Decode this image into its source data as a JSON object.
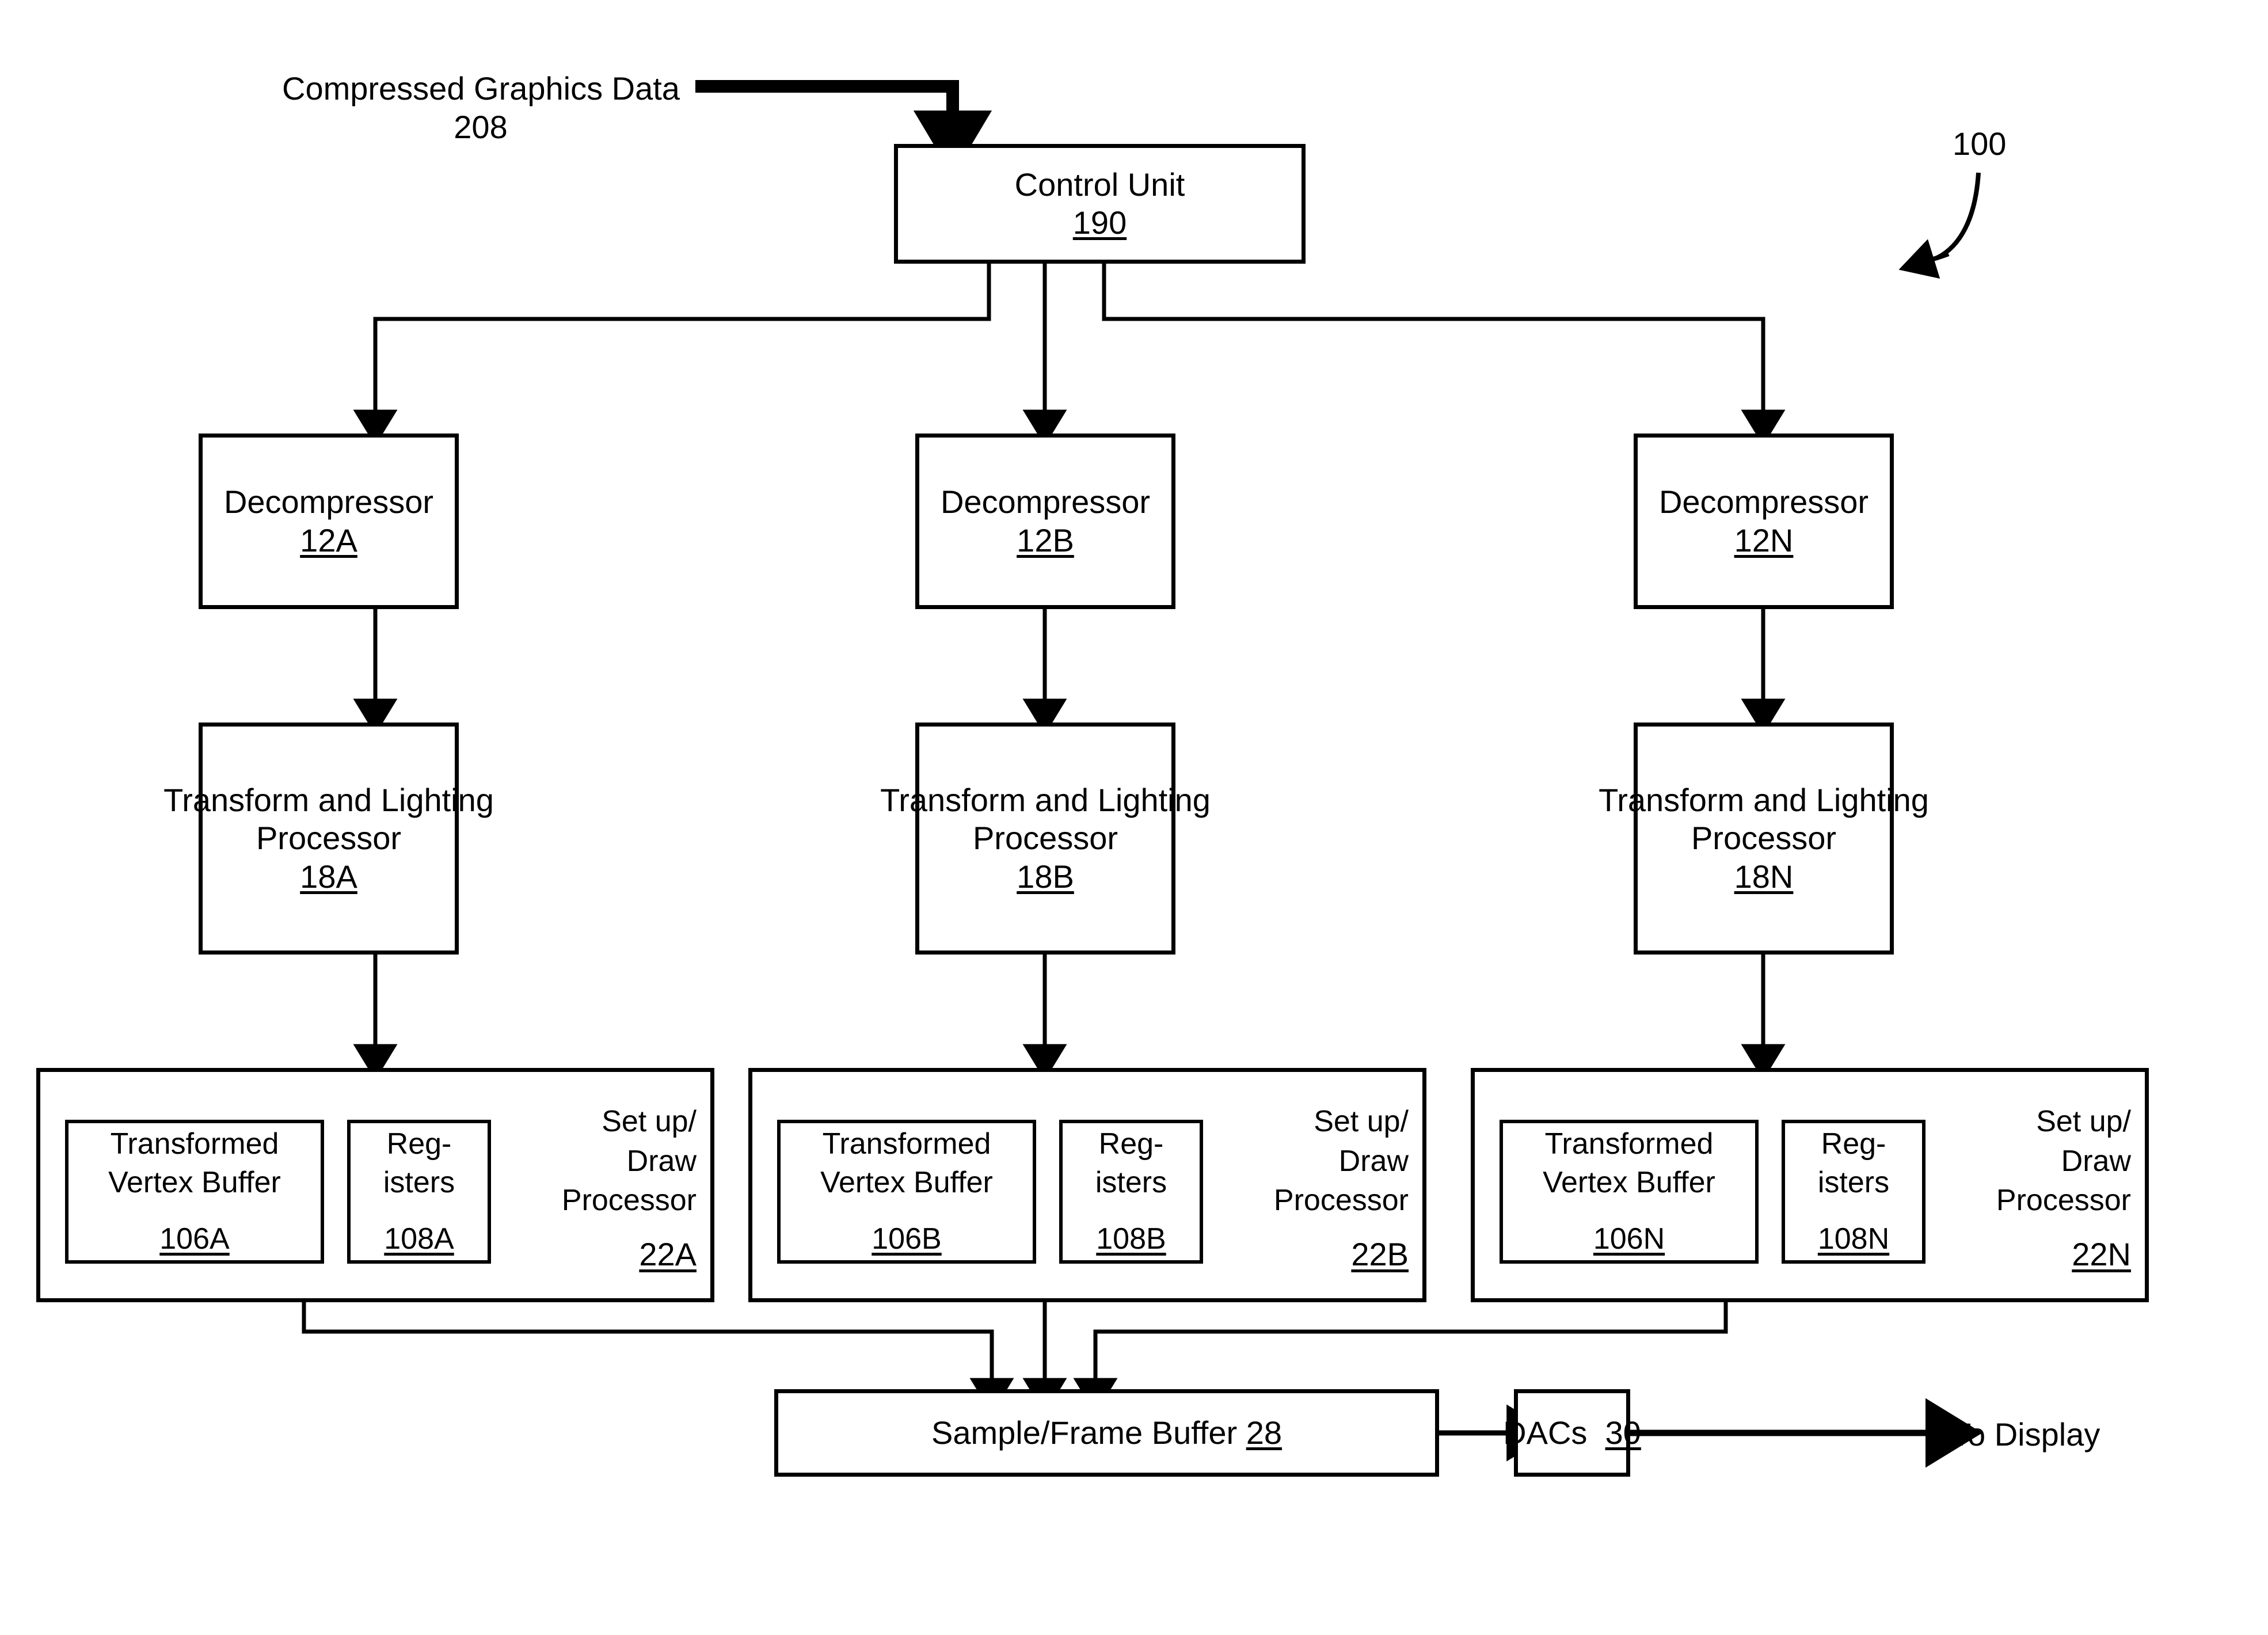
{
  "figure": {
    "reference_numeral": "100",
    "input_label": {
      "line1": "Compressed Graphics Data",
      "line2": "208"
    },
    "output_label": "To Display"
  },
  "control_unit": {
    "title": "Control Unit",
    "ref": "190"
  },
  "pipelines": [
    {
      "id": "A",
      "decompressor": {
        "title": "Decompressor",
        "ref": "12A"
      },
      "transform_lighting": {
        "line1": "Transform and Lighting",
        "line2": "Processor",
        "ref": "18A"
      },
      "setup_draw": {
        "line1": "Set up/",
        "line2": "Draw",
        "line3": "Processor",
        "ref": "22A",
        "vertex_buffer": {
          "line1": "Transformed",
          "line2": "Vertex Buffer",
          "ref": "106A"
        },
        "registers": {
          "line1": "Reg-",
          "line2": "isters",
          "ref": "108A"
        }
      }
    },
    {
      "id": "B",
      "decompressor": {
        "title": "Decompressor",
        "ref": "12B"
      },
      "transform_lighting": {
        "line1": "Transform and Lighting",
        "line2": "Processor",
        "ref": "18B"
      },
      "setup_draw": {
        "line1": "Set up/",
        "line2": "Draw",
        "line3": "Processor",
        "ref": "22B",
        "vertex_buffer": {
          "line1": "Transformed",
          "line2": "Vertex Buffer",
          "ref": "106B"
        },
        "registers": {
          "line1": "Reg-",
          "line2": "isters",
          "ref": "108B"
        }
      }
    },
    {
      "id": "N",
      "decompressor": {
        "title": "Decompressor",
        "ref": "12N"
      },
      "transform_lighting": {
        "line1": "Transform and Lighting",
        "line2": "Processor",
        "ref": "18N"
      },
      "setup_draw": {
        "line1": "Set up/",
        "line2": "Draw",
        "line3": "Processor",
        "ref": "22N",
        "vertex_buffer": {
          "line1": "Transformed",
          "line2": "Vertex Buffer",
          "ref": "106N"
        },
        "registers": {
          "line1": "Reg-",
          "line2": "isters",
          "ref": "108N"
        }
      }
    }
  ],
  "sample_frame_buffer": {
    "title": "Sample/Frame Buffer",
    "ref": "28"
  },
  "dacs": {
    "title": "DACs",
    "ref": "30"
  },
  "colors": {
    "ink": "#000000",
    "paper": "#ffffff"
  }
}
